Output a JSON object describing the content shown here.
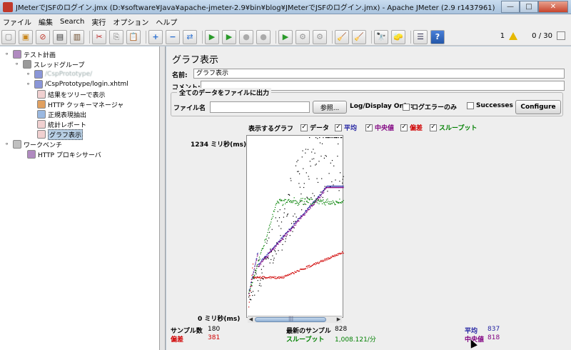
{
  "window": {
    "title": "JMeterでJSFのログイン.jmx (D:¥software¥Java¥apache-jmeter-2.9¥bin¥blog¥JMeterでJSFのログイン.jmx) - Apache JMeter (2.9 r1437961)",
    "min_glyph": "—",
    "max_glyph": "□",
    "close_glyph": "✕"
  },
  "menu": [
    "ファイル",
    "編集",
    "Search",
    "実行",
    "オプション",
    "ヘルプ"
  ],
  "toolbar": {
    "icons": [
      "new-icon",
      "open-icon",
      "close-file-icon",
      "save-icon",
      "save-as-icon",
      "cut-icon",
      "copy-icon",
      "paste-icon",
      "expand-icon",
      "collapse-icon",
      "toggle-icon",
      "start-icon",
      "start-no-pause-icon",
      "stop-icon",
      "shutdown-icon",
      "remote-start-icon",
      "remote-stop-icon",
      "remote-shutdown-icon",
      "clear-icon",
      "clear-all-icon",
      "search-icon",
      "reset-search-icon",
      "function-helper-icon",
      "help-icon"
    ],
    "glyphs": [
      "▢",
      "▣",
      "⊘",
      "▤",
      "▥",
      "✂",
      "⎘",
      "📋",
      "+",
      "−",
      "⇄",
      "▶",
      "▶",
      "●",
      "●",
      "▶",
      "⚙",
      "⚙",
      "🧹",
      "🧹",
      "🔭",
      "🧽",
      "☰",
      "?"
    ],
    "warning_count": "1",
    "thread_count": "0 / 30"
  },
  "tree": {
    "nodes": [
      {
        "label": "テスト計画",
        "depth": 0,
        "icon": "test-plan-icon",
        "color": "#8a5a9a"
      },
      {
        "label": "スレッドグループ",
        "depth": 1,
        "icon": "thread-group-icon",
        "color": "#7a7a7a"
      },
      {
        "label": "/CspPrototype/",
        "depth": 2,
        "icon": "http-sampler-icon",
        "color": "#6b79c8",
        "blurred": true
      },
      {
        "label": "/CspPrototype/login.xhtml",
        "depth": 2,
        "icon": "http-sampler-icon",
        "color": "#6b79c8",
        "blurred_prefix": true
      },
      {
        "label": "結果をツリーで表示",
        "depth": 2,
        "icon": "listener-icon",
        "color": "#d06060"
      },
      {
        "label": "HTTP クッキーマネージャ",
        "depth": 2,
        "icon": "cookie-manager-icon",
        "color": "#c07030"
      },
      {
        "label": "正規表現抽出",
        "depth": 2,
        "icon": "regex-extractor-icon",
        "color": "#5a8ac0"
      },
      {
        "label": "統計レポート",
        "depth": 2,
        "icon": "listener-icon",
        "color": "#d06060"
      },
      {
        "label": "グラフ表示",
        "depth": 2,
        "icon": "graph-listener-icon",
        "color": "#d06060",
        "selected": true
      },
      {
        "label": "ワークベンチ",
        "depth": 0,
        "icon": "workbench-icon",
        "color": "#808080"
      },
      {
        "label": "HTTP プロキシサーバ",
        "depth": 1,
        "icon": "proxy-icon",
        "color": "#8a5a9a"
      }
    ]
  },
  "panel": {
    "title": "グラフ表示",
    "name_label": "名前:",
    "name_value": "グラフ表示",
    "comment_label": "コメント:",
    "comment_value": "",
    "file_group_title": "全てのデータをファイルに出力",
    "filename_label": "ファイル名",
    "filename_value": "",
    "browse_button": "参照...",
    "log_display_label": "Log/Display Only:",
    "errors_only_label": "ログエラーのみ",
    "successes_label": "Successes",
    "configure_button": "Configure",
    "graphs_to_display_label": "表示するグラフ",
    "checks": [
      {
        "label": "データ",
        "color": "#000000",
        "checked": true
      },
      {
        "label": "平均",
        "color": "#1f1fa0",
        "checked": true
      },
      {
        "label": "中央値",
        "color": "#800080",
        "checked": true
      },
      {
        "label": "偏差",
        "color": "#d00000",
        "checked": true
      },
      {
        "label": "スループット",
        "color": "#008000",
        "checked": true
      }
    ],
    "check_glyph": "✓",
    "y_max_label": "1234 ミリ秒(ms)",
    "y_min_label": "0 ミリ秒(ms)",
    "scroll_left": "◀",
    "scroll_right": "▶"
  },
  "stats": {
    "samples_label": "サンプル数",
    "samples_value": "180",
    "latest_label": "最新のサンプル",
    "latest_value": "828",
    "average_label": "平均",
    "average_value": "837",
    "deviation_label": "偏差",
    "deviation_value": "381",
    "throughput_label": "スループット",
    "throughput_value": "1,008.121/分",
    "median_label": "中央値",
    "median_value": "818"
  },
  "colors": {
    "data": "#000000",
    "average": "#1f1fa0",
    "median": "#800080",
    "deviation": "#d00000",
    "throughput": "#008000"
  }
}
